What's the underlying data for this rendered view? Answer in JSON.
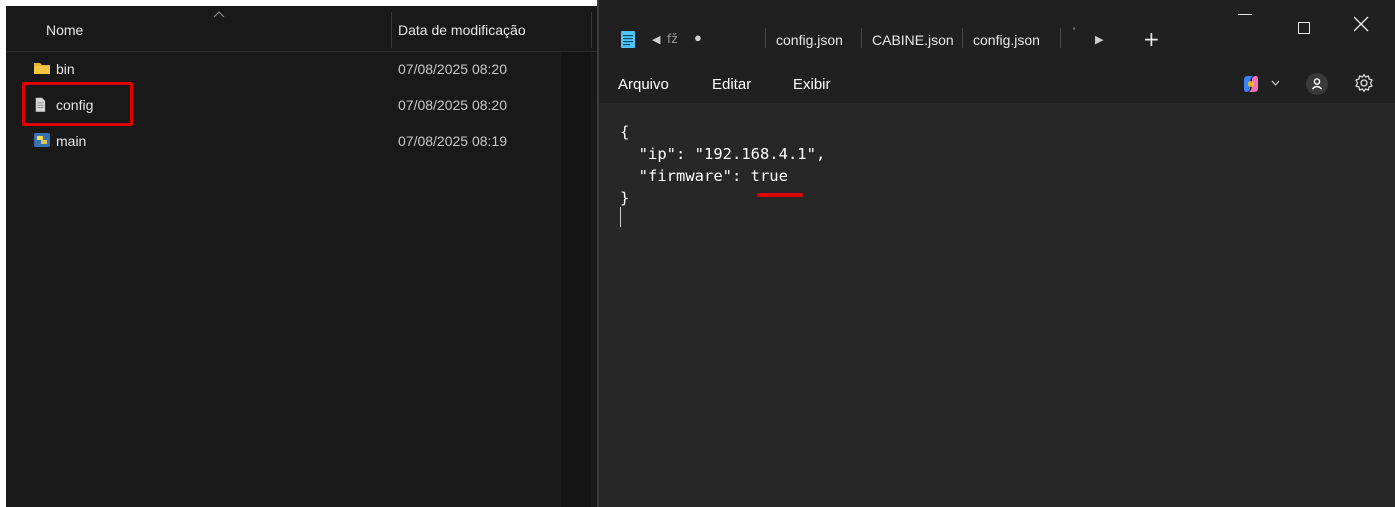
{
  "explorer": {
    "columns": {
      "name": "Nome",
      "date": "Data de modificação"
    },
    "files": [
      {
        "name": "bin",
        "date": "07/08/2025 08:20",
        "icon": "folder-icon"
      },
      {
        "name": "config",
        "date": "07/08/2025 08:20",
        "icon": "text-file-icon",
        "highlighted": true
      },
      {
        "name": "main",
        "date": "07/08/2025 08:19",
        "icon": "python-file-icon"
      }
    ]
  },
  "notepad": {
    "tabs": {
      "fragment": "fž",
      "items": [
        "config.json",
        "CABINE.json",
        "config.json"
      ]
    },
    "menu": {
      "file": "Arquivo",
      "edit": "Editar",
      "view": "Exibir"
    },
    "content": {
      "lines": [
        "{",
        "  \"ip\": \"192.168.4.1\",",
        "  \"firmware\": true",
        "}"
      ]
    },
    "colors": {
      "accent_red": "#e00000",
      "background": "#272727",
      "titlebar": "#202020"
    }
  }
}
